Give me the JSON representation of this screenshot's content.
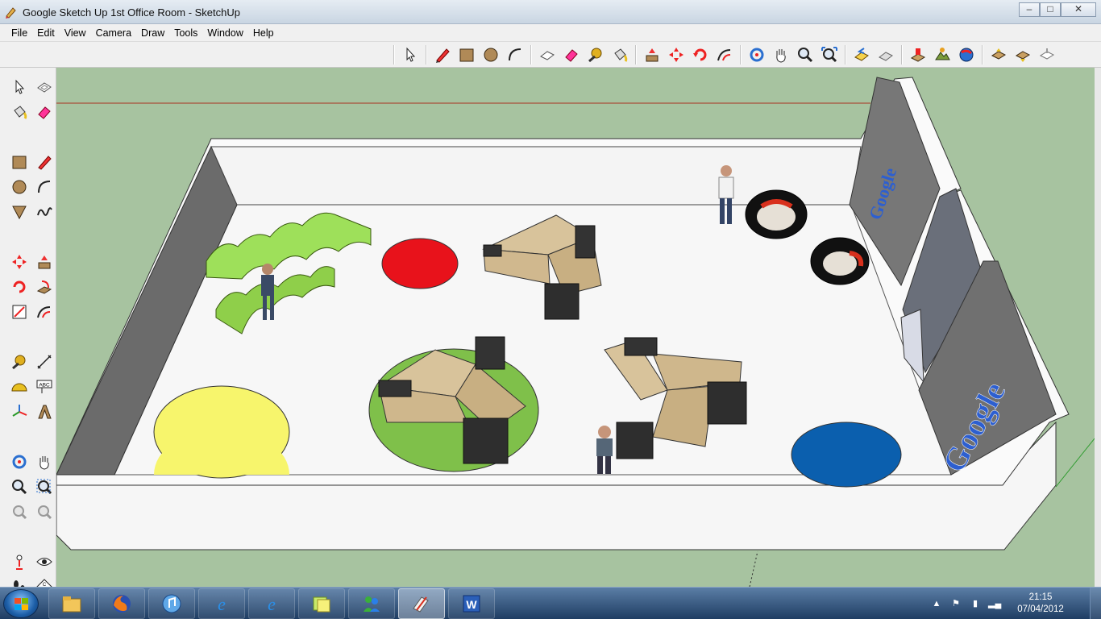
{
  "window": {
    "title": "Google Sketch Up 1st Office Room - SketchUp",
    "minimize": "–",
    "maximize": "□",
    "close": "✕"
  },
  "menu": [
    "File",
    "Edit",
    "View",
    "Camera",
    "Draw",
    "Tools",
    "Window",
    "Help"
  ],
  "toolbar": [
    "select-icon",
    "pencil-icon",
    "rectangle-icon",
    "circle-icon",
    "arc-icon",
    "make-component-icon",
    "eraser-icon",
    "tape-measure-icon",
    "paint-bucket-icon",
    "push-pull-icon",
    "move-icon",
    "rotate-icon",
    "offset-icon",
    "orbit-icon",
    "pan-icon",
    "zoom-icon",
    "zoom-extents-icon",
    "previous-view-icon",
    "next-view-icon",
    "add-location-icon",
    "toggle-terrain-icon",
    "get-models-icon",
    "share-model-icon",
    "share-component-icon"
  ],
  "palette": [
    "select-icon",
    "make-component-icon",
    "paint-bucket-icon",
    "eraser-icon",
    "rectangle-icon",
    "line-icon",
    "circle-icon",
    "arc-icon",
    "polygon-icon",
    "freehand-icon",
    "move-icon",
    "push-pull-icon",
    "rotate-icon",
    "follow-me-icon",
    "scale-icon",
    "offset-icon",
    "tape-measure-icon",
    "dimension-icon",
    "protractor-icon",
    "text-icon",
    "axes-icon",
    "3d-text-icon",
    "orbit-icon",
    "pan-icon",
    "zoom-icon",
    "zoom-window-icon",
    "zoom-extents-icon",
    "previous-icon",
    "position-camera-icon",
    "look-around-icon",
    "walk-icon",
    "section-plane-icon"
  ],
  "palette_text": {
    "text_tool": "ABC",
    "section_tool": "C"
  },
  "model_text": {
    "logo_back": "Google",
    "logo_right": "Google"
  },
  "colors": {
    "sky": "#a7c3a0",
    "floor": "#f7f7f7",
    "wall_side": "#6b6b6b",
    "red_rug": "#e8121b",
    "yellow_rug": "#f7f56c",
    "green_rug": "#7fc04a",
    "blue_rug": "#0b5fae",
    "desk_wood": "#d8c39b",
    "seat_green": "#9ee05a"
  },
  "taskbar": {
    "apps": [
      "explorer-icon",
      "firefox-icon",
      "itunes-icon",
      "ie-icon",
      "ie-icon",
      "sticky-notes-icon",
      "messenger-icon",
      "sketchup-icon",
      "word-icon"
    ],
    "active_index": 7,
    "time": "21:15",
    "date": "07/04/2012"
  }
}
